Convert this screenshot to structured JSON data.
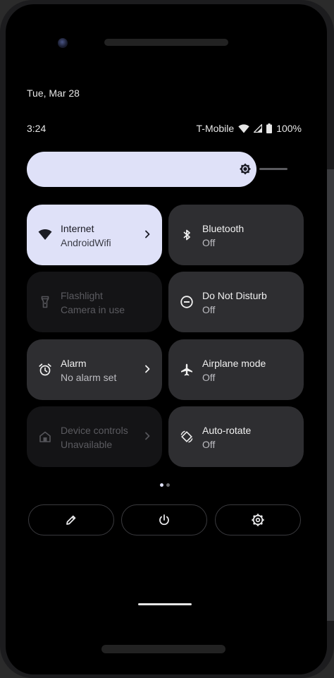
{
  "header": {
    "date": "Tue, Mar 28",
    "time": "3:24",
    "carrier": "T-Mobile",
    "battery": "100%"
  },
  "brightness": {
    "level": 0.88,
    "icon": "brightness-icon"
  },
  "tiles": [
    {
      "id": "internet",
      "title": "Internet",
      "subtitle": "AndroidWifi",
      "state": "active",
      "icon": "wifi-icon",
      "chevron": true
    },
    {
      "id": "bluetooth",
      "title": "Bluetooth",
      "subtitle": "Off",
      "state": "off",
      "icon": "bluetooth-icon",
      "chevron": false
    },
    {
      "id": "flashlight",
      "title": "Flashlight",
      "subtitle": "Camera in use",
      "state": "unavailable",
      "icon": "flashlight-icon",
      "chevron": false
    },
    {
      "id": "dnd",
      "title": "Do Not Disturb",
      "subtitle": "Off",
      "state": "off",
      "icon": "do-not-disturb-icon",
      "chevron": false
    },
    {
      "id": "alarm",
      "title": "Alarm",
      "subtitle": "No alarm set",
      "state": "off",
      "icon": "alarm-icon",
      "chevron": true
    },
    {
      "id": "airplane",
      "title": "Airplane mode",
      "subtitle": "Off",
      "state": "off",
      "icon": "airplane-icon",
      "chevron": false
    },
    {
      "id": "device-controls",
      "title": "Device controls",
      "subtitle": "Unavailable",
      "state": "unavailable",
      "icon": "home-icon",
      "chevron": true
    },
    {
      "id": "auto-rotate",
      "title": "Auto-rotate",
      "subtitle": "Off",
      "state": "off",
      "icon": "auto-rotate-icon",
      "chevron": false
    }
  ],
  "pager": {
    "pages": 2,
    "current": 1
  },
  "footer": {
    "edit_icon": "pencil-icon",
    "power_icon": "power-icon",
    "settings_icon": "gear-icon"
  },
  "colors": {
    "active_tile": "#dfe1f8",
    "inactive_tile": "#2e2e31",
    "unavailable_tile": "#141416",
    "background": "#000000"
  }
}
